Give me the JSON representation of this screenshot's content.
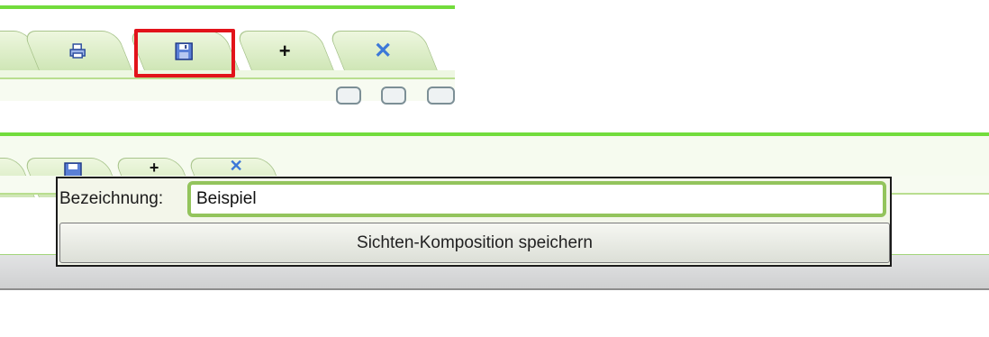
{
  "toolbar_top": {
    "tabs": [
      {
        "name": "tab-print",
        "icon": "print-icon"
      },
      {
        "name": "tab-save",
        "icon": "floppy-disk-icon",
        "selected": true
      },
      {
        "name": "tab-add",
        "icon": "plus-icon",
        "glyph": "+"
      },
      {
        "name": "tab-close",
        "icon": "close-icon",
        "glyph": "✕"
      }
    ],
    "highlight_color": "#e2131b"
  },
  "dialog": {
    "label": "Bezeichnung:",
    "input_value": "Beispiel",
    "save_button_label": "Sichten-Komposition speichern"
  },
  "colors": {
    "accent_green": "#72dc3c",
    "tab_fill": "#cfe6b6",
    "close_blue": "#3c78d8"
  }
}
